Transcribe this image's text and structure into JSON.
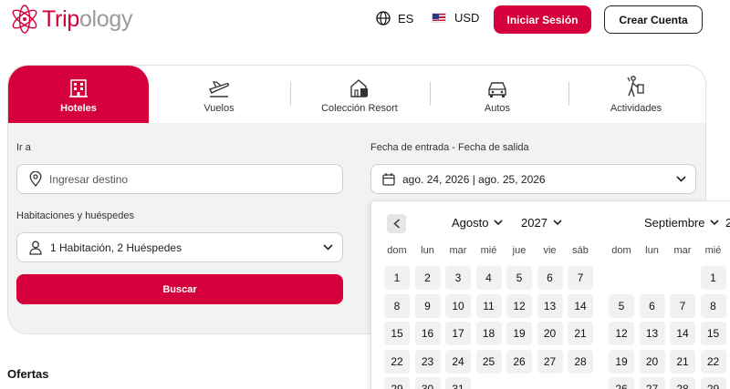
{
  "header": {
    "logo_text_a": "Trip",
    "logo_text_b": "ology",
    "language": "ES",
    "currency": "USD",
    "login_label": "Iniciar Sesión",
    "signup_label": "Crear Cuenta"
  },
  "tabs": [
    {
      "label": "Hoteles",
      "icon": "hotel-icon",
      "active": true
    },
    {
      "label": "Vuelos",
      "icon": "plane-icon",
      "active": false
    },
    {
      "label": "Colección Resort",
      "icon": "resort-icon",
      "active": false
    },
    {
      "label": "Autos",
      "icon": "car-icon",
      "active": false
    },
    {
      "label": "Actividades",
      "icon": "activities-icon",
      "active": false
    }
  ],
  "form": {
    "destination_label": "Ir a",
    "destination_placeholder": "Ingresar destino",
    "dates_label": "Fecha de entrada - Fecha de salida",
    "dates_value": "ago. 24, 2026 | ago. 25, 2026",
    "rooms_label": "Habitaciones y huéspedes",
    "rooms_value": "1 Habitación, 2 Huéspedes",
    "search_label": "Buscar"
  },
  "offers_title": "Ofertas",
  "calendar": {
    "left_month": "Agosto",
    "left_year": "2027",
    "right_month": "Septiembre",
    "right_year_partial": "2",
    "weekdays": [
      "dom",
      "lun",
      "mar",
      "mié",
      "jue",
      "vie",
      "sáb"
    ],
    "left_rows": [
      [
        "1",
        "2",
        "3",
        "4",
        "5",
        "6",
        "7"
      ],
      [
        "8",
        "9",
        "10",
        "11",
        "12",
        "13",
        "14"
      ],
      [
        "15",
        "16",
        "17",
        "18",
        "19",
        "20",
        "21"
      ],
      [
        "22",
        "23",
        "24",
        "25",
        "26",
        "27",
        "28"
      ],
      [
        "29",
        "30",
        "31",
        "",
        "",
        "",
        ""
      ]
    ],
    "right_rows": [
      [
        "",
        "",
        "",
        "1"
      ],
      [
        "5",
        "6",
        "7",
        "8"
      ],
      [
        "12",
        "13",
        "14",
        "15"
      ],
      [
        "19",
        "20",
        "21",
        "22"
      ],
      [
        "26",
        "27",
        "28",
        "29"
      ]
    ]
  },
  "colors": {
    "brand": "#d5003c",
    "panel": "#f2f2f2"
  }
}
